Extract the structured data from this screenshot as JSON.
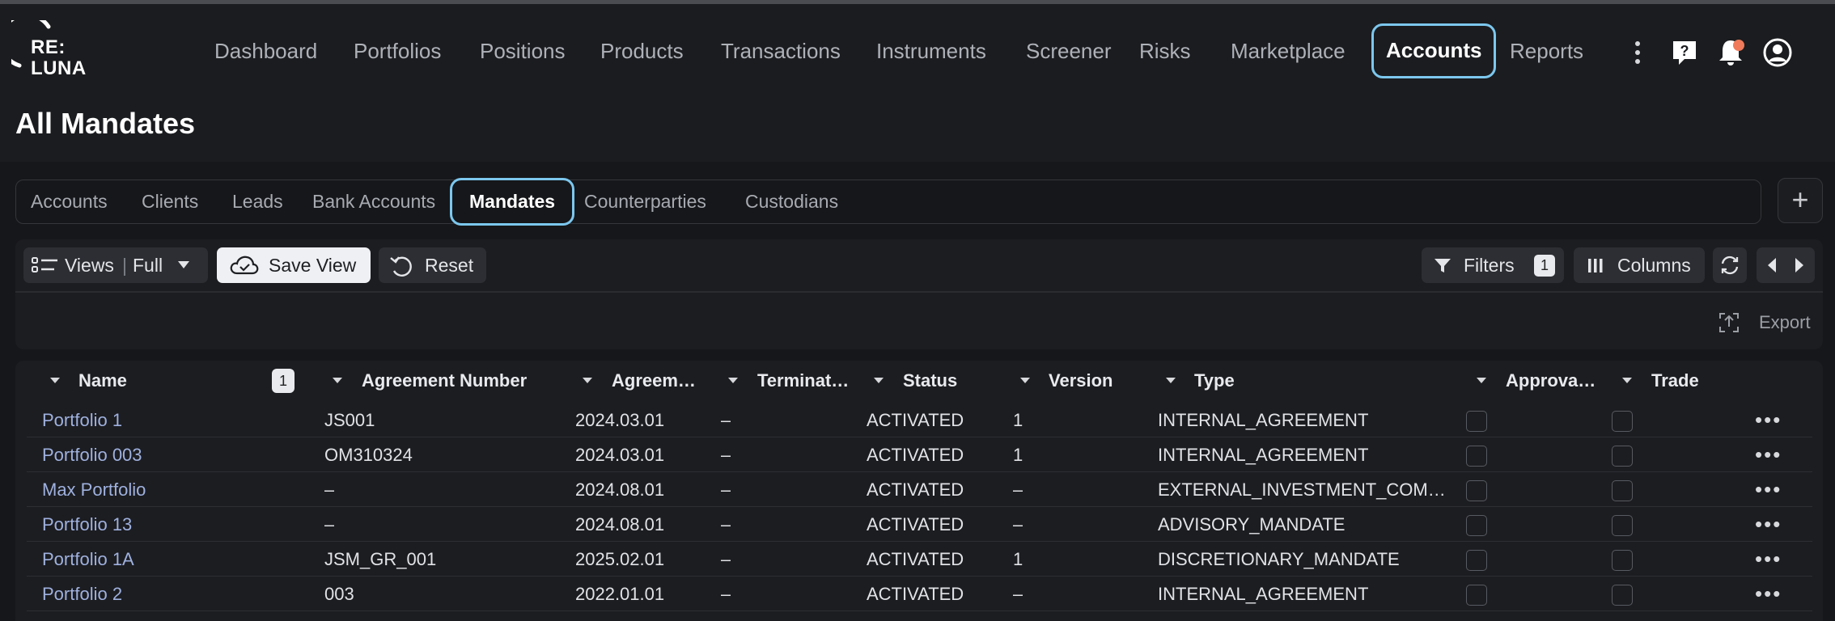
{
  "logo": {
    "line1": "RE:",
    "line2": "LUNA"
  },
  "nav": {
    "items": [
      "Dashboard",
      "Portfolios",
      "Positions",
      "Products",
      "Transactions",
      "Instruments",
      "Screener",
      "Risks",
      "Marketplace",
      "Accounts",
      "Reports"
    ],
    "active": "Accounts"
  },
  "header_icons": [
    "more-vertical-icon",
    "help-icon",
    "bell-icon",
    "user-icon"
  ],
  "page": {
    "title": "All Mandates"
  },
  "tabs": {
    "items": [
      "Accounts",
      "Clients",
      "Leads",
      "Bank Accounts",
      "Mandates",
      "Counterparties",
      "Custodians"
    ],
    "active": "Mandates",
    "add_label": "+"
  },
  "toolbar": {
    "views_label": "Views",
    "view_name": "Full",
    "save_view": "Save View",
    "reset": "Reset",
    "filters": "Filters",
    "filter_count": "1",
    "columns": "Columns",
    "export": "Export"
  },
  "table": {
    "name_filter_count": "1",
    "columns": [
      "Name",
      "Agreement Number",
      "Agreem…",
      "Terminat…",
      "Status",
      "Version",
      "Type",
      "Approva…",
      "Trade"
    ],
    "rows": [
      {
        "name": "Portfolio 1",
        "agreement_number": "JS001",
        "agreement_date": "2024.03.01",
        "termination": "–",
        "status": "ACTIVATED",
        "version": "1",
        "type": "INTERNAL_AGREEMENT"
      },
      {
        "name": "Portfolio 003",
        "agreement_number": "OM310324",
        "agreement_date": "2024.03.01",
        "termination": "–",
        "status": "ACTIVATED",
        "version": "1",
        "type": "INTERNAL_AGREEMENT"
      },
      {
        "name": "Max Portfolio",
        "agreement_number": "–",
        "agreement_date": "2024.08.01",
        "termination": "–",
        "status": "ACTIVATED",
        "version": "–",
        "type": "EXTERNAL_INVESTMENT_COM…"
      },
      {
        "name": "Portfolio 13",
        "agreement_number": "–",
        "agreement_date": "2024.08.01",
        "termination": "–",
        "status": "ACTIVATED",
        "version": "–",
        "type": "ADVISORY_MANDATE"
      },
      {
        "name": "Portfolio 1A",
        "agreement_number": "JSM_GR_001",
        "agreement_date": "2025.02.01",
        "termination": "–",
        "status": "ACTIVATED",
        "version": "1",
        "type": "DISCRETIONARY_MANDATE"
      },
      {
        "name": "Portfolio 2",
        "agreement_number": "003",
        "agreement_date": "2022.01.01",
        "termination": "–",
        "status": "ACTIVATED",
        "version": "–",
        "type": "INTERNAL_AGREEMENT"
      }
    ]
  },
  "colors": {
    "accent": "#7cc7ee",
    "link": "#9fb1df",
    "background": "#1b1c1f",
    "notification": "#f07a5a"
  }
}
